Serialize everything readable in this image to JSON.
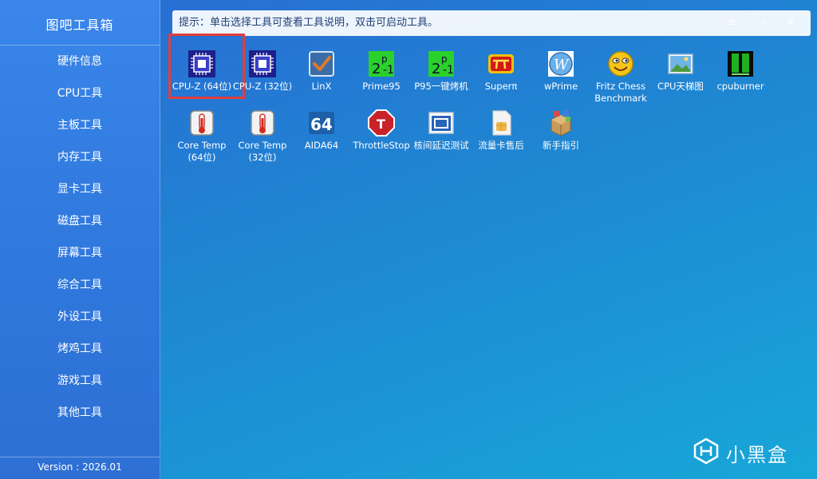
{
  "sidebar": {
    "title": "图吧工具箱",
    "items": [
      {
        "label": "硬件信息"
      },
      {
        "label": "CPU工具"
      },
      {
        "label": "主板工具"
      },
      {
        "label": "内存工具"
      },
      {
        "label": "显卡工具"
      },
      {
        "label": "磁盘工具"
      },
      {
        "label": "屏幕工具"
      },
      {
        "label": "综合工具"
      },
      {
        "label": "外设工具"
      },
      {
        "label": "烤鸡工具"
      },
      {
        "label": "游戏工具"
      },
      {
        "label": "其他工具"
      }
    ],
    "version": "Version : 2026.01"
  },
  "header": {
    "hint": "提示：单击选择工具可查看工具说明，双击可启动工具。",
    "menu_icon": "≡",
    "minimize_icon": "–",
    "close_icon": "✕"
  },
  "tools": [
    {
      "label": "CPU-Z (64位)",
      "icon": "cpu-chip-icon",
      "selected": true
    },
    {
      "label": "CPU-Z (32位)",
      "icon": "cpu-chip-icon"
    },
    {
      "label": "LinX",
      "icon": "checkbox-icon"
    },
    {
      "label": "Prime95",
      "icon": "prime95-icon"
    },
    {
      "label": "P95一键烤机",
      "icon": "prime95-icon"
    },
    {
      "label": "Superπ",
      "icon": "superpi-icon"
    },
    {
      "label": "wPrime",
      "icon": "wprime-icon"
    },
    {
      "label": "Fritz Chess\nBenchmark",
      "icon": "smiley-face-icon"
    },
    {
      "label": "CPU天梯图",
      "icon": "picture-icon"
    },
    {
      "label": "cpuburner",
      "icon": "cpuburner-icon"
    },
    {
      "label": "Core Temp\n(64位)",
      "icon": "thermometer-icon"
    },
    {
      "label": "Core Temp\n(32位)",
      "icon": "thermometer-icon"
    },
    {
      "label": "AIDA64",
      "icon": "aida64-icon"
    },
    {
      "label": "ThrottleStop",
      "icon": "stop-sign-icon"
    },
    {
      "label": "核间延迟测试",
      "icon": "window-icon"
    },
    {
      "label": "流量卡售后",
      "icon": "sim-card-icon"
    },
    {
      "label": "新手指引",
      "icon": "package-icon"
    }
  ],
  "watermark": {
    "text": "小黑盒"
  },
  "colors": {
    "accent_selection": "#e13e3e",
    "sidebar_bg": "#2f78dd"
  }
}
